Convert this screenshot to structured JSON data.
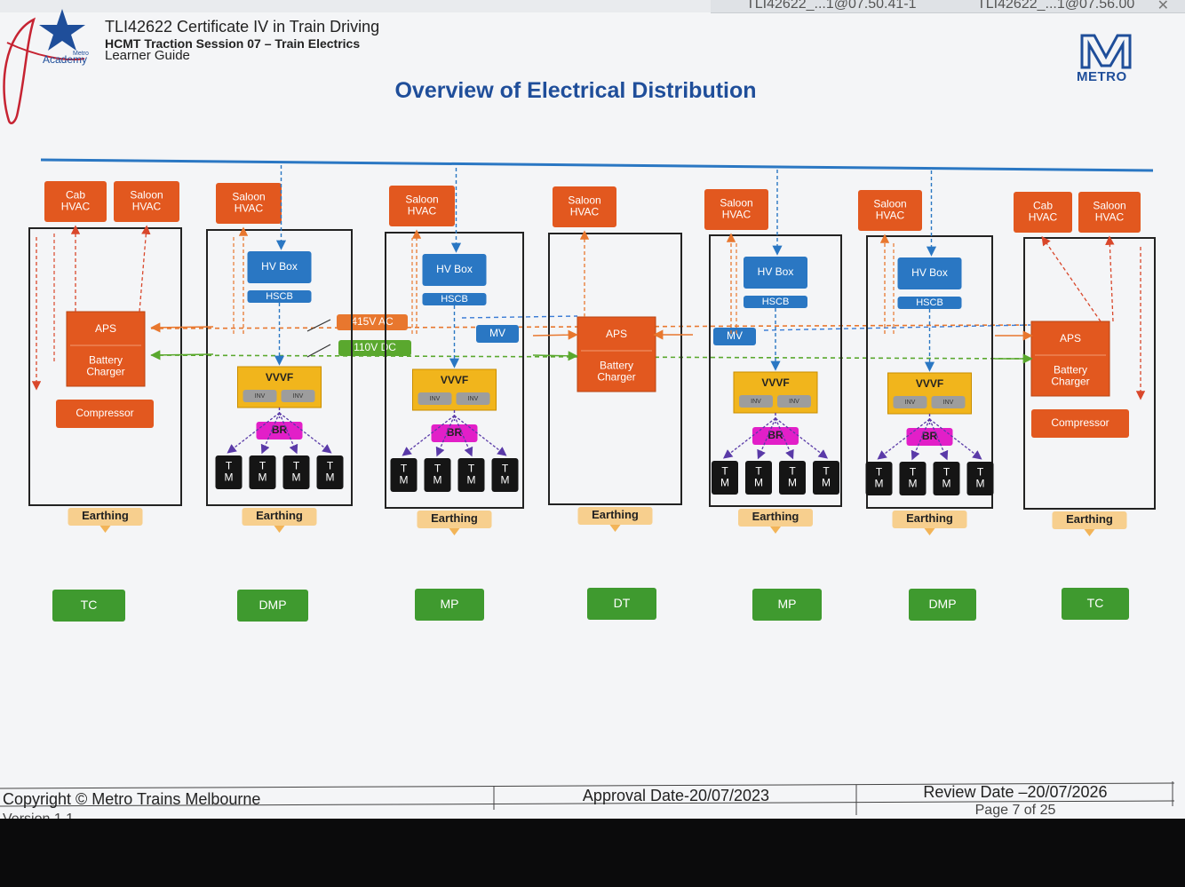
{
  "window_tabs": [
    {
      "label": "TLI42622_...1@07.50.41-1"
    },
    {
      "label": "TLI42622_...1@07.56.00"
    }
  ],
  "header": {
    "logo_text": "Academy",
    "logo_small": "Metro",
    "course": "TLI42622 Certificate IV in Train Driving",
    "session": "HCMT Traction Session 07 – Train Electrics",
    "guide": "Learner Guide",
    "brand": "METRO"
  },
  "title": "Overview of Electrical Distribution",
  "diagram": {
    "bus_labels": {
      "ac": "415V AC",
      "dc": "110V DC"
    },
    "colors": {
      "hvac": "#e2581f",
      "aps": "#e2581f",
      "hvbox": "#2a77c3",
      "vvvf": "#f1b51c",
      "br": "#e21fc8",
      "tm": "#151515",
      "earthing": "#f7cf8e",
      "car_label": "#3f9a2f",
      "ac_bus": "#e8772e",
      "dc_bus": "#5aa82e",
      "hv_line": "#2a77c3"
    },
    "cars": [
      {
        "id": "TC",
        "label": "TC",
        "hvac": [
          "Cab\nHVAC",
          "Saloon\nHVAC"
        ],
        "aps": "APS",
        "charger": "Battery\nCharger",
        "compressor": "Compressor",
        "earthing": "Earthing"
      },
      {
        "id": "DMP",
        "label": "DMP",
        "hvac": [
          "Saloon\nHVAC"
        ],
        "hvbox": "HV Box",
        "hscb": "HSCB",
        "vvvf": "VVVF",
        "inv": [
          "INV",
          "INV"
        ],
        "br": "BR",
        "tm": [
          "T\nM",
          "T\nM",
          "T\nM",
          "T\nM"
        ],
        "earthing": "Earthing"
      },
      {
        "id": "MP",
        "label": "MP",
        "hvac": [
          "Saloon\nHVAC"
        ],
        "hvbox": "HV Box",
        "hscb": "HSCB",
        "mv": "MV",
        "vvvf": "VVVF",
        "inv": [
          "INV",
          "INV"
        ],
        "br": "BR",
        "tm": [
          "T\nM",
          "T\nM",
          "T\nM",
          "T\nM"
        ],
        "earthing": "Earthing"
      },
      {
        "id": "DT",
        "label": "DT",
        "hvac": [
          "Saloon\nHVAC"
        ],
        "aps": "APS",
        "charger": "Battery\nCharger",
        "earthing": "Earthing"
      },
      {
        "id": "MP2",
        "label": "MP",
        "hvac": [
          "Saloon\nHVAC"
        ],
        "hvbox": "HV Box",
        "hscb": "HSCB",
        "mv": "MV",
        "vvvf": "VVVF",
        "inv": [
          "INV",
          "INV"
        ],
        "br": "BR",
        "tm": [
          "T\nM",
          "T\nM",
          "T\nM",
          "T\nM"
        ],
        "earthing": "Earthing"
      },
      {
        "id": "DMP2",
        "label": "DMP",
        "hvac": [
          "Saloon\nHVAC"
        ],
        "hvbox": "HV Box",
        "hscb": "HSCB",
        "vvvf": "VVVF",
        "inv": [
          "INV",
          "INV"
        ],
        "br": "BR",
        "tm": [
          "T\nM",
          "T\nM",
          "T\nM",
          "T\nM"
        ],
        "earthing": "Earthing"
      },
      {
        "id": "TC2",
        "label": "TC",
        "hvac": [
          "Cab\nHVAC",
          "Saloon\nHVAC"
        ],
        "aps": "APS",
        "charger": "Battery\nCharger",
        "compressor": "Compressor",
        "earthing": "Earthing"
      }
    ]
  },
  "footer": {
    "copyright": "Copyright © Metro Trains Melbourne",
    "version": "Version 1.1",
    "approval": "Approval Date-20/07/2023",
    "review": "Review Date –20/07/2026",
    "page": "Page 7 of 25"
  }
}
